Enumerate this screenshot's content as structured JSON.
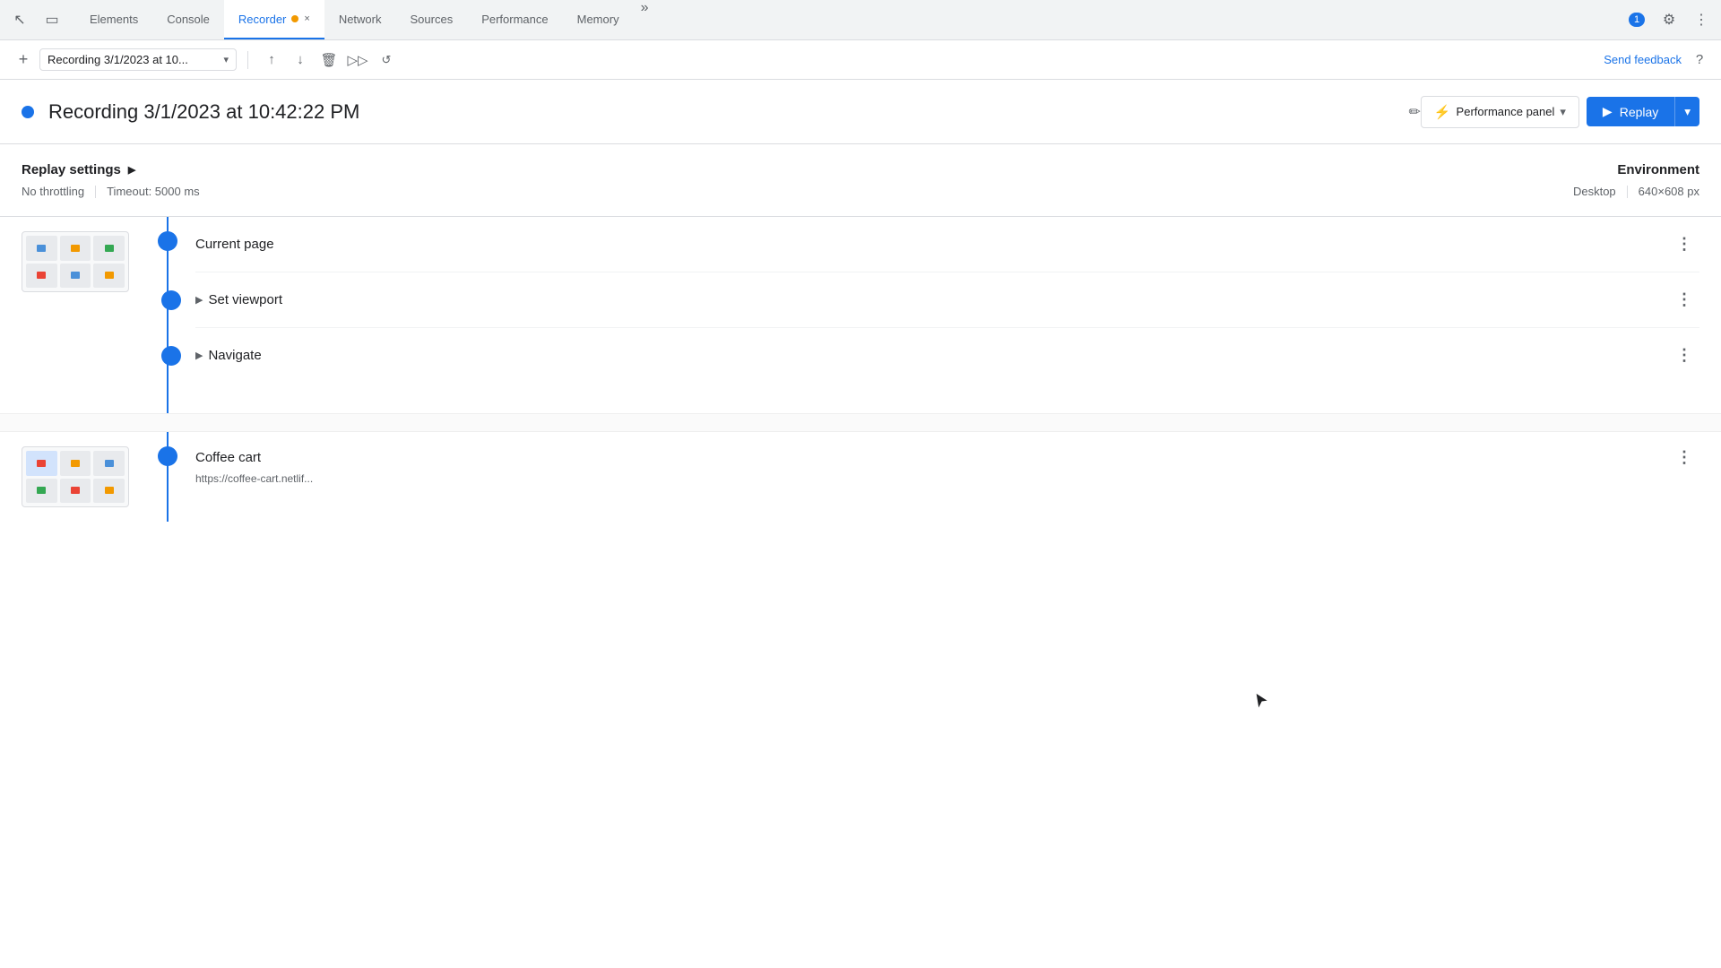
{
  "tabs": {
    "items": [
      {
        "label": "Elements",
        "active": false,
        "id": "elements"
      },
      {
        "label": "Console",
        "active": false,
        "id": "console"
      },
      {
        "label": "Recorder",
        "active": true,
        "id": "recorder",
        "hasClose": true,
        "hasDot": true
      },
      {
        "label": "Network",
        "active": false,
        "id": "network"
      },
      {
        "label": "Sources",
        "active": false,
        "id": "sources"
      },
      {
        "label": "Performance",
        "active": false,
        "id": "performance"
      },
      {
        "label": "Memory",
        "active": false,
        "id": "memory"
      }
    ],
    "more_label": "»"
  },
  "toolbar": {
    "add_tooltip": "+",
    "recording_name": "Recording 3/1/2023 at 10...",
    "send_feedback": "Send feedback",
    "export_tooltip": "Export",
    "import_tooltip": "Import",
    "delete_tooltip": "Delete",
    "play_tooltip": "Play",
    "schedule_tooltip": "Schedule"
  },
  "notification": {
    "count": "1"
  },
  "recording": {
    "title": "Recording 3/1/2023 at 10:42:22 PM",
    "dot_color": "#1a73e8"
  },
  "performance_panel": {
    "label": "Performance panel"
  },
  "replay": {
    "label": "Replay"
  },
  "replay_settings": {
    "title": "Replay settings",
    "throttling": "No throttling",
    "timeout": "Timeout: 5000 ms"
  },
  "environment": {
    "title": "Environment",
    "device": "Desktop",
    "resolution": "640×608 px"
  },
  "steps": [
    {
      "id": "current-page",
      "title": "Current page",
      "has_thumbnail": true,
      "sub_steps": []
    },
    {
      "id": "set-viewport",
      "title": "Set viewport",
      "has_chevron": true,
      "sub_steps": []
    },
    {
      "id": "navigate",
      "title": "Navigate",
      "has_chevron": true,
      "sub_steps": []
    }
  ],
  "second_page": {
    "title": "Coffee cart",
    "subtitle": "https://coffee-cart.netlif...",
    "has_thumbnail": true
  },
  "icons": {
    "cursor": "⌖",
    "edit": "✏",
    "play": "▶",
    "chevron_right": "▶",
    "chevron_down": "▼",
    "more": "⋮",
    "plus": "+",
    "help": "?",
    "close": "×",
    "upload": "↑",
    "download": "↓",
    "delete": "🗑",
    "gear": "⚙"
  }
}
